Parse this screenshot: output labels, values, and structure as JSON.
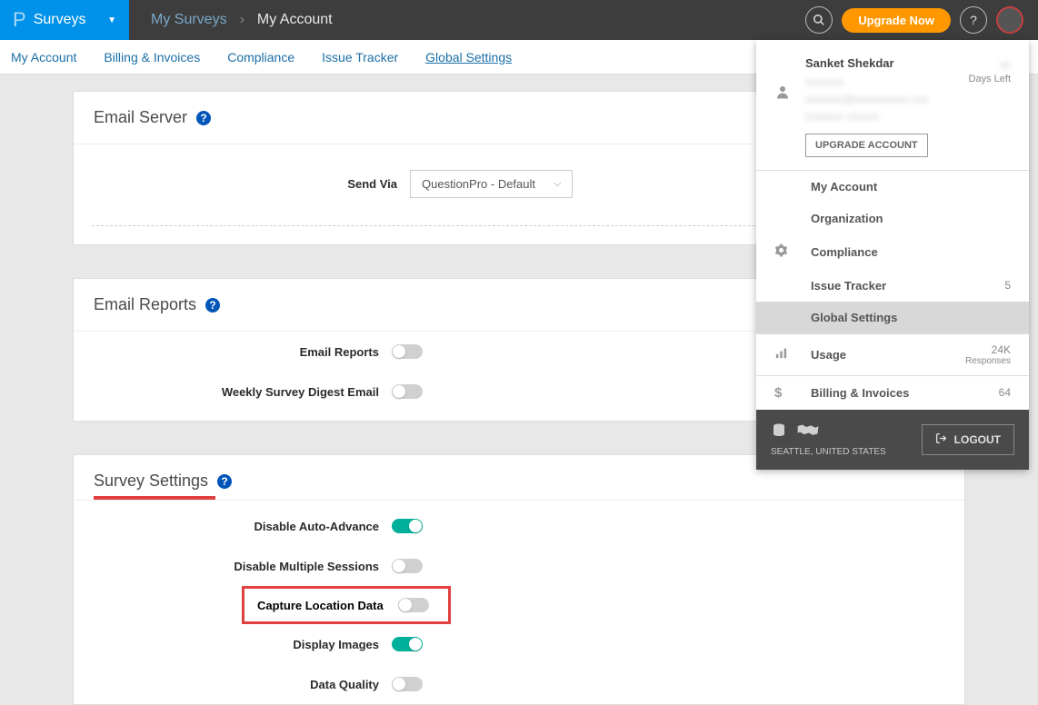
{
  "topbar": {
    "brand_text": "Surveys",
    "breadcrumb": {
      "first": "My Surveys",
      "last": "My Account"
    },
    "upgrade_label": "Upgrade Now"
  },
  "subnav": {
    "items": [
      "My Account",
      "Billing & Invoices",
      "Compliance",
      "Issue Tracker",
      "Global Settings"
    ],
    "active": "Global Settings"
  },
  "email_server": {
    "title": "Email Server",
    "send_via_label": "Send Via",
    "send_via_value": "QuestionPro - Default"
  },
  "email_reports": {
    "title": "Email Reports",
    "rows": [
      {
        "label": "Email Reports",
        "on": false
      },
      {
        "label": "Weekly Survey Digest Email",
        "on": false
      }
    ]
  },
  "survey_settings": {
    "title": "Survey Settings",
    "rows": [
      {
        "label": "Disable Auto-Advance",
        "on": true
      },
      {
        "label": "Disable Multiple Sessions",
        "on": false
      },
      {
        "label": "Capture Location Data",
        "on": false,
        "highlighted": true
      },
      {
        "label": "Display Images",
        "on": true
      },
      {
        "label": "Data Quality",
        "on": false
      }
    ]
  },
  "dropdown": {
    "user_name": "Sanket Shekdar",
    "days_left": "Days Left",
    "upgrade_account": "UPGRADE ACCOUNT",
    "items": [
      {
        "label": "My Account"
      },
      {
        "label": "Organization"
      },
      {
        "label": "Compliance"
      },
      {
        "label": "Issue Tracker",
        "value": "5"
      },
      {
        "label": "Global Settings",
        "active": true
      },
      {
        "label": "Usage",
        "value": "24K",
        "sub": "Responses"
      },
      {
        "label": "Billing & Invoices",
        "value": "64"
      }
    ],
    "location": "SEATTLE, UNITED STATES",
    "logout": "LOGOUT"
  }
}
